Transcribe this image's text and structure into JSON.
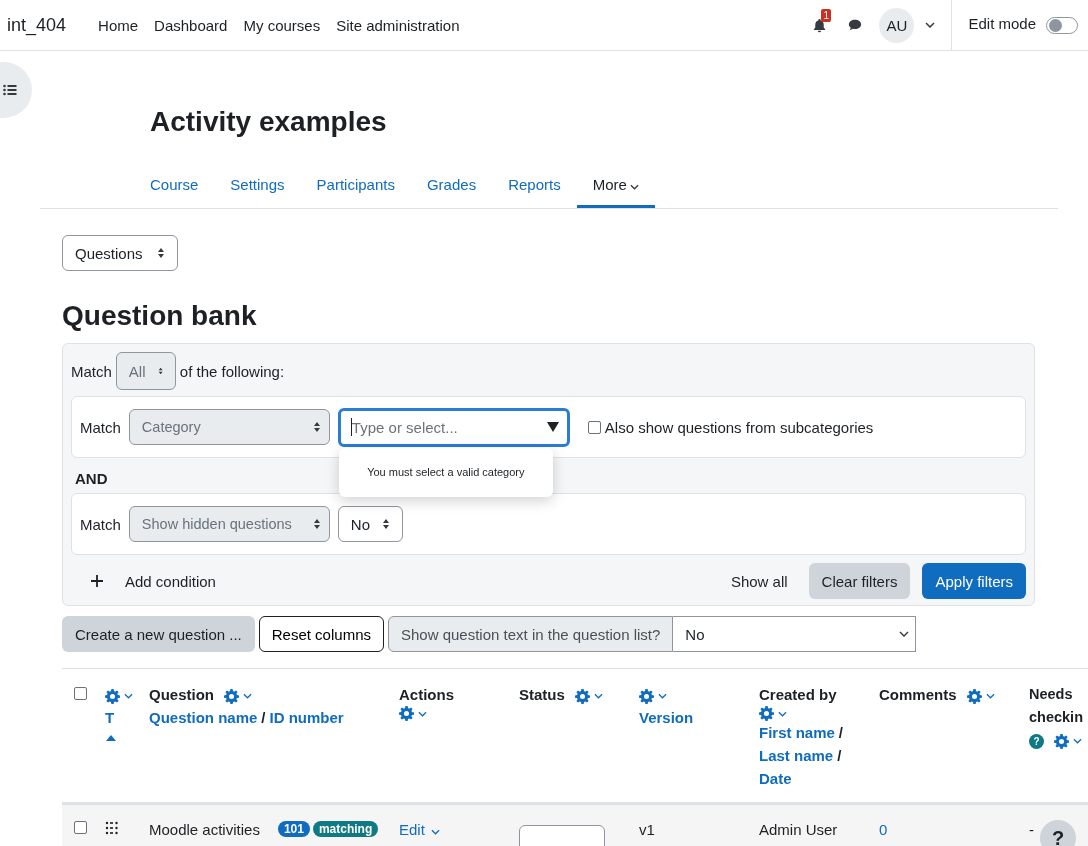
{
  "navbar": {
    "site_name": "int_404",
    "links": [
      {
        "label": "Home"
      },
      {
        "label": "Dashboard"
      },
      {
        "label": "My courses"
      },
      {
        "label": "Site administration"
      }
    ],
    "notification_count": "1",
    "avatar_initials": "AU",
    "edit_mode": {
      "label": "Edit mode",
      "on": false
    }
  },
  "course": {
    "title": "Activity examples",
    "tabs": [
      {
        "label": "Course",
        "selected": false,
        "dropdown": false
      },
      {
        "label": "Settings",
        "selected": false,
        "dropdown": false
      },
      {
        "label": "Participants",
        "selected": false,
        "dropdown": false
      },
      {
        "label": "Grades",
        "selected": false,
        "dropdown": false
      },
      {
        "label": "Reports",
        "selected": false,
        "dropdown": false
      },
      {
        "label": "More",
        "selected": true,
        "dropdown": true
      }
    ]
  },
  "page_select": {
    "value": "Questions"
  },
  "heading": "Question bank",
  "filters": {
    "match_prefix": "Match",
    "match_value": "All",
    "match_suffix": "of the following:",
    "joiner": "AND",
    "conditions": [
      {
        "kind": "category",
        "label": "Match",
        "type": "Category",
        "placeholder": "Type or select...",
        "error": "You must select a valid category",
        "subcategories": {
          "label": "Also show questions from subcategories",
          "checked": false
        }
      },
      {
        "kind": "choice",
        "label": "Match",
        "type": "Show hidden questions",
        "value": "No"
      }
    ],
    "add_condition": "Add condition",
    "show_all": "Show all",
    "clear": "Clear filters",
    "apply": "Apply filters"
  },
  "toolbar": {
    "create": "Create a new question ...",
    "reset": "Reset columns",
    "show_text_label": "Show question text in the question list?",
    "show_text_value": "No"
  },
  "table": {
    "separator": "/",
    "columns": [
      {
        "kind": "select",
        "checked": false
      },
      {
        "kind": "type",
        "sorts": [
          "T"
        ],
        "sort_up": true
      },
      {
        "kind": "question",
        "title": "Question",
        "sorts": [
          "Question name",
          "ID number"
        ]
      },
      {
        "kind": "actions",
        "title": "Actions"
      },
      {
        "kind": "status",
        "title": "Status"
      },
      {
        "kind": "version",
        "sorts": [
          "Version"
        ]
      },
      {
        "kind": "created",
        "title": "Created by",
        "sorts": [
          "First name",
          "Last name",
          "Date"
        ]
      },
      {
        "kind": "comments",
        "title": "Comments"
      },
      {
        "kind": "needs",
        "title": "Needs checkin",
        "help": "?"
      }
    ],
    "rows": [
      {
        "checked": false,
        "name": "Moodle activities",
        "usage": "101",
        "qtype": "matching",
        "action": "Edit",
        "version": "v1",
        "created_by": "Admin User",
        "comments": "0",
        "needs_checking": "-"
      }
    ]
  },
  "help_button": "?"
}
